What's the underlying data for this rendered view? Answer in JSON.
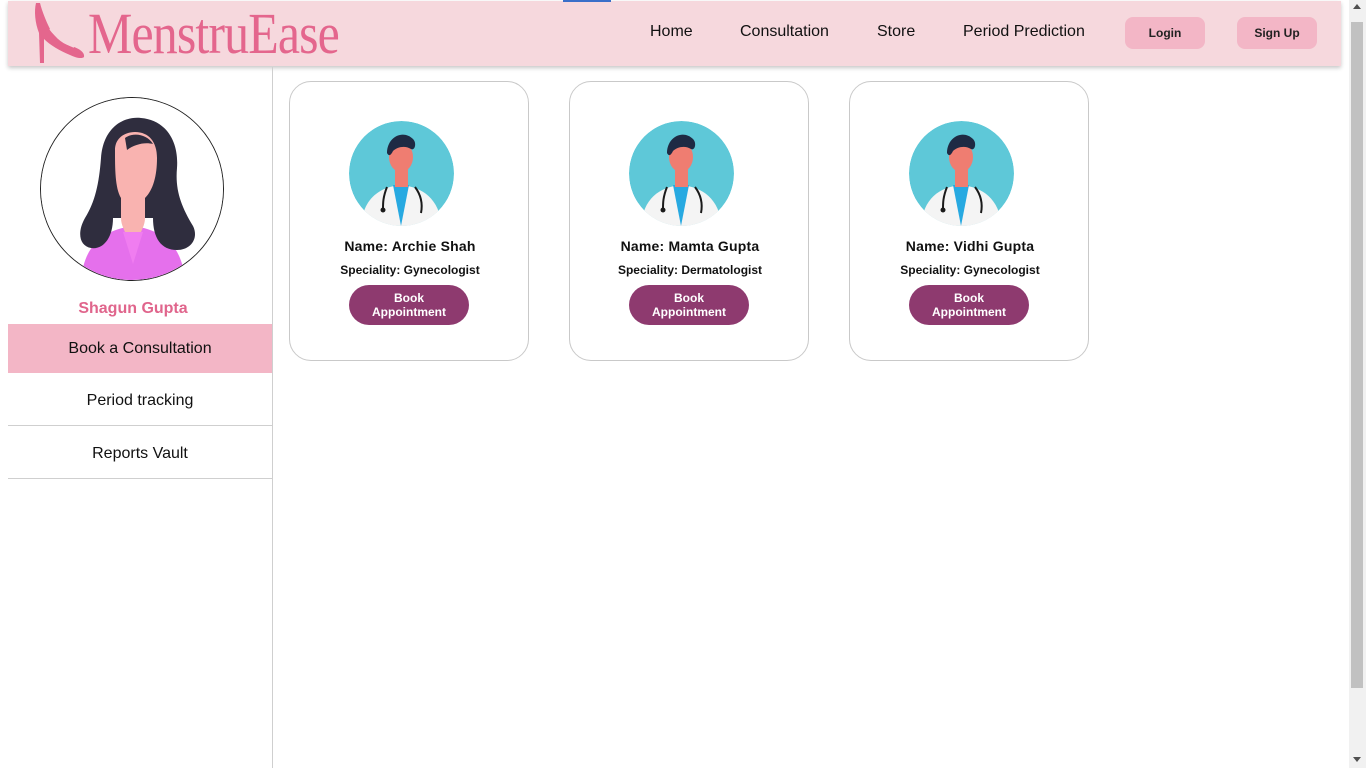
{
  "header": {
    "brand": "MenstruEase",
    "nav": [
      "Home",
      "Consultation",
      "Store",
      "Period Prediction"
    ],
    "login_label": "Login",
    "signup_label": "Sign Up"
  },
  "sidebar": {
    "user_name": "Shagun Gupta",
    "items": [
      {
        "label": "Book a Consultation",
        "active": true
      },
      {
        "label": "Period tracking",
        "active": false
      },
      {
        "label": "Reports Vault",
        "active": false
      }
    ]
  },
  "doctors": [
    {
      "name": "Name: Archie Shah",
      "speciality_label": "Speciality:",
      "speciality": "Gynecologist",
      "button": "Book Appointment"
    },
    {
      "name": "Name: Mamta Gupta",
      "speciality_label": "Speciality:",
      "speciality": "Dermatologist",
      "button": "Book Appointment"
    },
    {
      "name": "Name: Vidhi Gupta",
      "speciality_label": "Speciality:",
      "speciality": "Gynecologist",
      "button": "Book Appointment"
    }
  ],
  "colors": {
    "header_bg": "#f6d8dd",
    "brand": "#e4668d",
    "accent_pink": "#f3b6c6",
    "button_plum": "#8e3a6f",
    "doctor_bg": "#5ec8d8"
  },
  "icons": {
    "logo": "high-heel-icon",
    "avatar": "woman-avatar",
    "doctor": "doctor-avatar"
  }
}
